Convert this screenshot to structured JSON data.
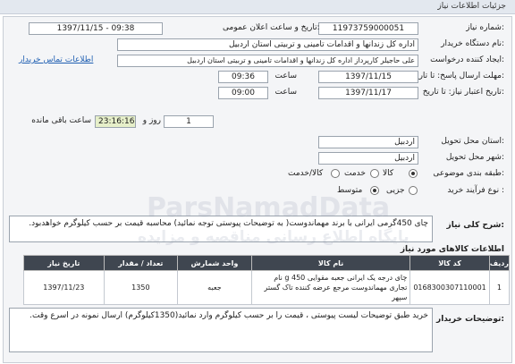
{
  "header": {
    "title": "جزئیات اطلاعات نیاز"
  },
  "fields": {
    "need_number_label": "شماره نیاز:",
    "need_number": "11973759000051",
    "announce_label": "تاریخ و ساعت اعلان عمومی:",
    "announce_value": "1397/11/15 - 09:38",
    "buyer_label": "نام دستگاه خریدار:",
    "buyer_value": "اداره کل زندانها و اقدامات تامینی و تربیتی استان اردبیل",
    "creator_label": "ایجاد کننده درخواست:",
    "creator_value": "علی  حاجیلر کارپرداز  اداره کل زندانها و اقدامات تامینی و تربیتی استان اردبیل",
    "contact_link": "اطلاعات تماس خریدار",
    "send_deadline_label": "مهلت ارسال پاسخ: تا تاریخ:",
    "send_date": "1397/11/15",
    "time_label": "ساعت",
    "send_time": "09:36",
    "validity_label": "تاریخ اعتبار نیاز: تا تاریخ:",
    "validity_date": "1397/11/17",
    "validity_time": "09:00",
    "days": "1",
    "day_and": "روز و",
    "remaining_time": "23:16:16",
    "remaining_label": "ساعت باقی مانده",
    "province_label": "استان محل تحویل:",
    "province": "اردبیل",
    "city_label": "شهر محل تحویل:",
    "city": "اردبیل",
    "category_label": "طبقه بندی موضوعی:",
    "category_options": [
      "کالا",
      "خدمت",
      "کالا/خدمت"
    ],
    "process_label": "نوع فرآیند خرید :",
    "process_options": [
      "جزیی",
      "متوسط"
    ]
  },
  "need_description": {
    "label": "شرح کلی نیاز:",
    "text": "چای 450گرمی ایرانی با برند مهماندوست( به توضیحات پیوستی توجه نمائید) محاسبه قیمت بر حسب کیلوگرم خواهدبود."
  },
  "goods_section": {
    "title": "اطلاعات کالاهای مورد نیاز"
  },
  "goods_table": {
    "columns": [
      "ردیف",
      "کد کالا",
      "نام کالا",
      "واحد شمارش",
      "تعداد / مقدار",
      "تاریخ نیاز"
    ],
    "rows": [
      {
        "row": "1",
        "code": "0168300307110001",
        "name": "چای درجه یک ایرانی جعبه مقوایی 450 g نام تجاری مهماندوست مرجع عرضه کننده تاک گستر سپهر",
        "unit": "جعبه",
        "qty": "1350",
        "date": "1397/11/23"
      }
    ]
  },
  "buyer_notes": {
    "label": "توضیحات خریدار:",
    "text": "خرید طبق توضیحات لیست پیوستی ، قیمت را بر حسب کیلوگرم وارد نمائید(1350کیلوگرم) ارسال نمونه در اسرع وقت."
  },
  "watermark": {
    "text": "ParsNamadData",
    "subtext": "پایگاه اطلاع رسانی مناقصه و مزایده"
  }
}
